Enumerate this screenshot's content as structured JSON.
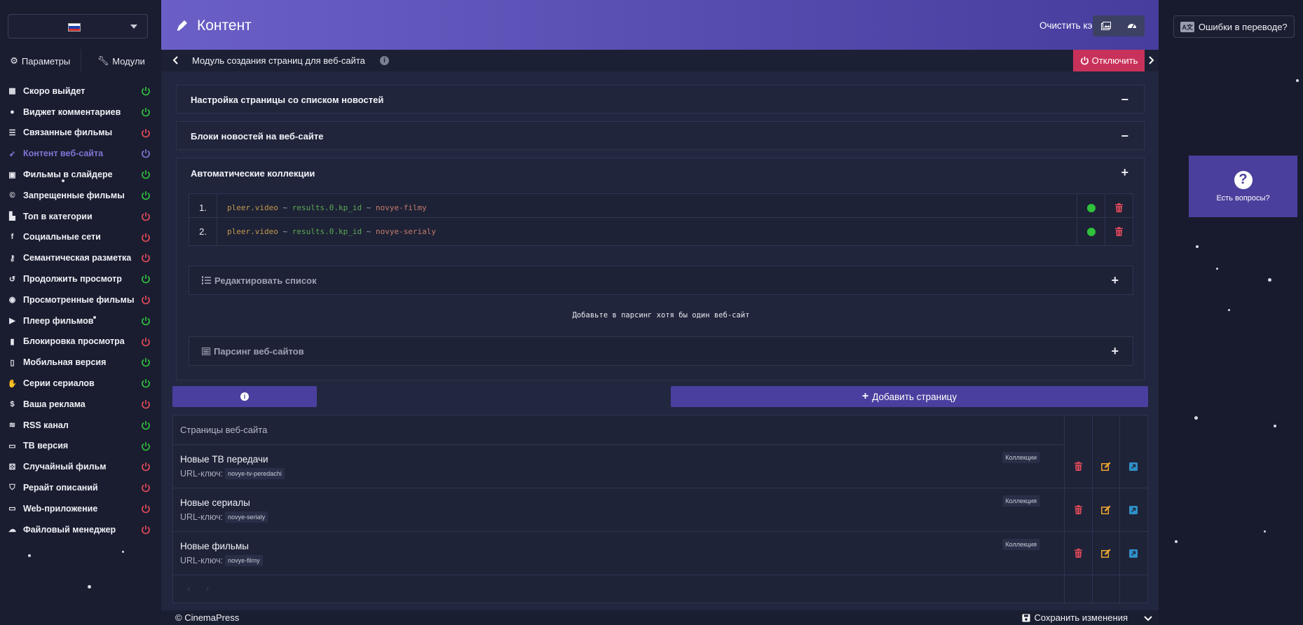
{
  "language": {
    "flag_colors": [
      "#ffffff",
      "#1c3fae",
      "#d62c2c"
    ]
  },
  "sidebar": {
    "tabs": [
      {
        "label": "Параметры",
        "icon": "gears-icon"
      },
      {
        "label": "Модули",
        "icon": "wrench-icon"
      }
    ],
    "items": [
      {
        "label": "Скоро выйдет",
        "icon": "calendar-icon",
        "status": "on"
      },
      {
        "label": "Виджет комментариев",
        "icon": "comments-icon",
        "status": "on"
      },
      {
        "label": "Связанные фильмы",
        "icon": "list-icon",
        "status": "off"
      },
      {
        "label": "Контент веб-сайта",
        "icon": "rocket-icon",
        "status": "active"
      },
      {
        "label": "Фильмы в слайдере",
        "icon": "images-icon",
        "status": "on"
      },
      {
        "label": "Запрещенные фильмы",
        "icon": "copyright-icon",
        "status": "on"
      },
      {
        "label": "Топ в категории",
        "icon": "chart-icon",
        "status": "off"
      },
      {
        "label": "Социальные сети",
        "icon": "facebook-icon",
        "status": "off"
      },
      {
        "label": "Семантическая разметка",
        "icon": "key-icon",
        "status": "off"
      },
      {
        "label": "Продолжить просмотр",
        "icon": "history-icon",
        "status": "on"
      },
      {
        "label": "Просмотренные фильмы",
        "icon": "eye-icon",
        "status": "off"
      },
      {
        "label": "Плеер фильмов",
        "icon": "play-icon",
        "status": "on"
      },
      {
        "label": "Блокировка просмотра",
        "icon": "lock-icon",
        "status": "off"
      },
      {
        "label": "Мобильная версия",
        "icon": "mobile-icon",
        "status": "on"
      },
      {
        "label": "Серии сериалов",
        "icon": "hand-icon",
        "status": "on"
      },
      {
        "label": "Ваша реклама",
        "icon": "dollar-icon",
        "status": "off"
      },
      {
        "label": "RSS канал",
        "icon": "rss-icon",
        "status": "on"
      },
      {
        "label": "ТВ версия",
        "icon": "tv-icon",
        "status": "on"
      },
      {
        "label": "Случайный фильм",
        "icon": "dice-icon",
        "status": "off"
      },
      {
        "label": "Рерайт описаний",
        "icon": "shield-icon",
        "status": "off"
      },
      {
        "label": "Web-приложение",
        "icon": "desktop-icon",
        "status": "off"
      },
      {
        "label": "Файловый менеджер",
        "icon": "cloud-upload-icon",
        "status": "off"
      }
    ]
  },
  "header": {
    "title": "Контент",
    "clear_cache_label": "Очистить кэш:"
  },
  "module": {
    "title": "Модуль создания страниц для веб-сайта",
    "info_glyph": "i",
    "disable_label": "Отключить"
  },
  "panels": {
    "list_settings": "Настройка страницы со списком новостей",
    "news_blocks": "Блоки новостей на веб-сайте",
    "auto_collections": "Автоматические коллекции",
    "collapse_glyph": "−",
    "expand_glyph": "+"
  },
  "collections": [
    {
      "num": "1.",
      "source": "pleer.video",
      "sep": " ~ ",
      "key": "results.0.kp_id",
      "slug": "novye-filmy"
    },
    {
      "num": "2.",
      "source": "pleer.video",
      "sep": " ~ ",
      "key": "results.0.kp_id",
      "slug": "novye-serialy"
    }
  ],
  "edit_list_label": "Редактировать список",
  "parsing_hint": "Добавьте в парсинг хотя бы один веб-сайт",
  "parsing_label": "Парсинг веб-сайтов",
  "add_page_label": "Добавить страницу",
  "pages": {
    "header": "Страницы веб-сайта",
    "url_label": "URL-ключ:",
    "rows": [
      {
        "name": "Новые ТВ передачи",
        "url_key": "novye-tv-peredachi",
        "tag": "Коллекции"
      },
      {
        "name": "Новые сериалы",
        "url_key": "novye-serialy",
        "tag": "Коллекция"
      },
      {
        "name": "Новые фильмы",
        "url_key": "novye-filmy",
        "tag": "Коллекция"
      }
    ],
    "pager": [
      "‹",
      "›"
    ]
  },
  "footer": {
    "copyright": "© CinemaPress",
    "save_label": "Сохранить изменения"
  },
  "right": {
    "errors_label": "Ошибки в переводе?",
    "aa_glyph": "A文",
    "faq_label": "Есть вопросы?",
    "faq_glyph": "?"
  },
  "colors": {
    "on": "#2fc13b",
    "off": "#e04a5a",
    "active": "#7f74d4",
    "accent": "#4a3f9e",
    "danger": "#c8325a",
    "edit": "#f0a830",
    "open": "#2f8fc8"
  }
}
